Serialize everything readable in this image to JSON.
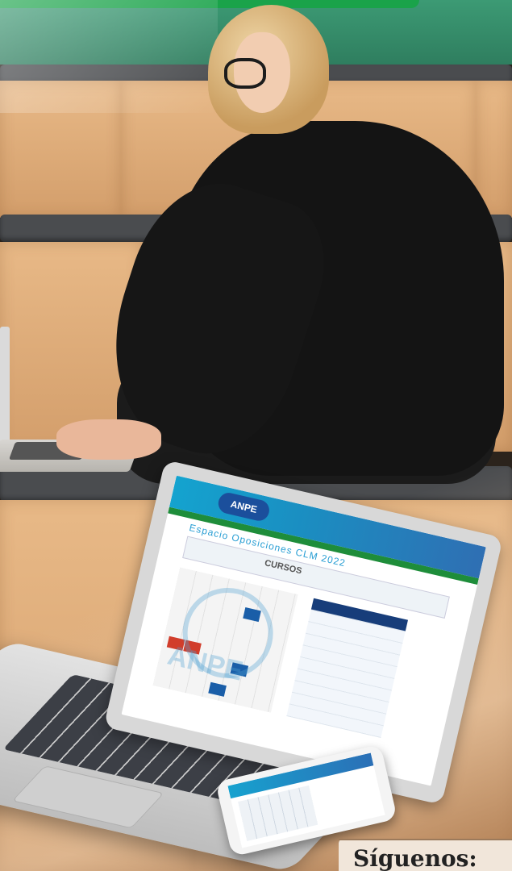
{
  "site_preview": {
    "logo_text": "ANPE",
    "section_title": "Espacio Oposiciones CLM 2022",
    "banner_text": "CURSOS",
    "watermark_text": "ANPE"
  },
  "follow_label": "Síguenos:",
  "colors": {
    "brand_green": "#1aa34a",
    "brand_blue": "#1a5ea8",
    "accent_cyan": "#14a3cf"
  }
}
